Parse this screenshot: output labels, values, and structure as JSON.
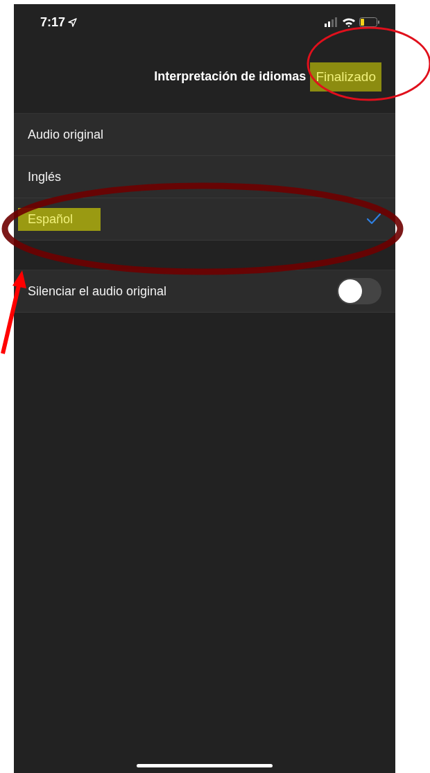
{
  "status_bar": {
    "time": "7:17"
  },
  "nav": {
    "title": "Interpretación de idiomas",
    "done": {
      "label": "Finalizado",
      "highlighted": true
    }
  },
  "languages": [
    {
      "label": "Audio original",
      "selected": false,
      "highlighted": false
    },
    {
      "label": "Inglés",
      "selected": false,
      "highlighted": false
    },
    {
      "label": "Español",
      "selected": true,
      "highlighted": true
    }
  ],
  "mute_original": {
    "label": "Silenciar el audio original",
    "on": false
  },
  "annotations": [
    {
      "kind": "circle",
      "color": "#e0101c"
    },
    {
      "kind": "ellipse",
      "color": "#6e0000"
    },
    {
      "kind": "arrow",
      "color": "#ff0000"
    }
  ]
}
